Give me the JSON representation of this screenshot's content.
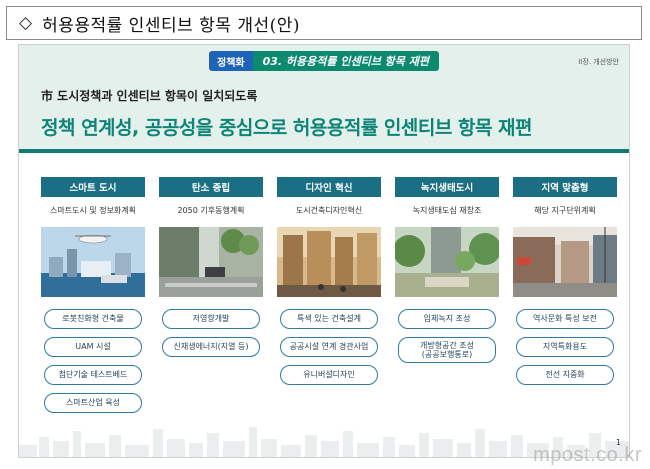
{
  "header": {
    "icon": "diamond-outline-icon",
    "title": "허용용적률 인센티브 항목 개선(안)"
  },
  "slide": {
    "tag_label": "정책화",
    "tag_title": "03. 허용용적률 인센티브 항목 재편",
    "corner_note": "II장. 개선방안",
    "subtitle": "市 도시정책과 인센티브 항목이 일치되도록",
    "headline": "정책 연계성, 공공성을 중심으로 허용용적률 인센티브 항목 재편",
    "page_number": "1",
    "accent_color": "#0e8476",
    "header_color": "#1b6f84"
  },
  "columns": [
    {
      "title": "스마트 도시",
      "subtitle": "스마트도시 및 정보화계획",
      "items": [
        "로봇친화형 건축물",
        "UAM 시설",
        "첨단기술 테스트베드",
        "스마트산업 육성"
      ]
    },
    {
      "title": "탄소 중립",
      "subtitle": "2050 기후동행계획",
      "items": [
        "저영향개발",
        "신재생에너지(지열 등)"
      ]
    },
    {
      "title": "디자인 혁신",
      "subtitle": "도시건축디자인혁신",
      "items": [
        "특색 있는 건축설계",
        "공공시설 연계 경관사업",
        "유니버설디자인"
      ]
    },
    {
      "title": "녹지생태도시",
      "subtitle": "녹지생태도심 재창조",
      "items": [
        "입체녹지 조성",
        "개방형공간 조성\n(공공보행통로)"
      ]
    },
    {
      "title": "지역 맞춤형",
      "subtitle": "해당 지구단위계획",
      "items": [
        "역사문화 특성 보전",
        "지역특화용도",
        "전선 지중화"
      ]
    }
  ],
  "watermark": "mpost.co.kr"
}
